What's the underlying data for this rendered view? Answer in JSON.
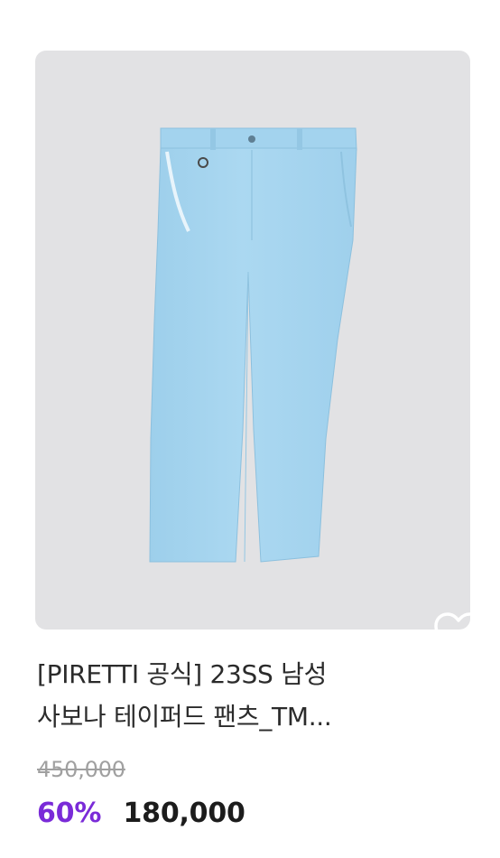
{
  "product": {
    "image_alt": "light blue pants",
    "title_line1": "[PIRETTI 공식] 23SS 남성",
    "title_line2": "사보나 테이퍼드 팬츠_TM...",
    "original_price": "450,000",
    "discount_rate": "60%",
    "sale_price": "180,000",
    "wishlist_icon": "heart-outline-icon"
  },
  "colors": {
    "image_background": "#e2e2e4",
    "pants": "#a7d5ef",
    "discount": "#7a2bd8",
    "price": "#1c1c1c",
    "strikethrough": "#a0a0a0"
  }
}
